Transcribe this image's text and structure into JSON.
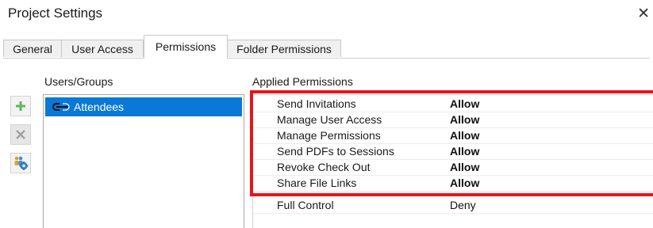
{
  "window": {
    "title": "Project Settings",
    "close_glyph": "✕"
  },
  "tabs": [
    {
      "label": "General",
      "active": false
    },
    {
      "label": "User Access",
      "active": false
    },
    {
      "label": "Permissions",
      "active": true
    },
    {
      "label": "Folder Permissions",
      "active": false
    }
  ],
  "users_pane": {
    "heading": "Users/Groups",
    "toolbar": [
      {
        "icon": "plus-icon",
        "enabled": true
      },
      {
        "icon": "remove-icon",
        "enabled": false
      },
      {
        "icon": "user-settings-icon",
        "enabled": true
      }
    ],
    "items": [
      {
        "label": "Attendees",
        "icon": "group-link-icon",
        "selected": true
      }
    ]
  },
  "permissions_pane": {
    "heading": "Applied Permissions",
    "rows": [
      {
        "name": "Send Invitations",
        "value": "Allow",
        "highlighted": true
      },
      {
        "name": "Manage User Access",
        "value": "Allow",
        "highlighted": true
      },
      {
        "name": "Manage Permissions",
        "value": "Allow",
        "highlighted": true
      },
      {
        "name": "Send PDFs to Sessions",
        "value": "Allow",
        "highlighted": true
      },
      {
        "name": "Revoke Check Out",
        "value": "Allow",
        "highlighted": true
      },
      {
        "name": "Share File Links",
        "value": "Allow",
        "highlighted": true
      },
      {
        "name": "Full Control",
        "value": "Deny",
        "highlighted": false
      }
    ]
  },
  "colors": {
    "selection": "#0a78d7",
    "highlight_border": "#e8141b",
    "plus_green": "#5cb85c"
  }
}
